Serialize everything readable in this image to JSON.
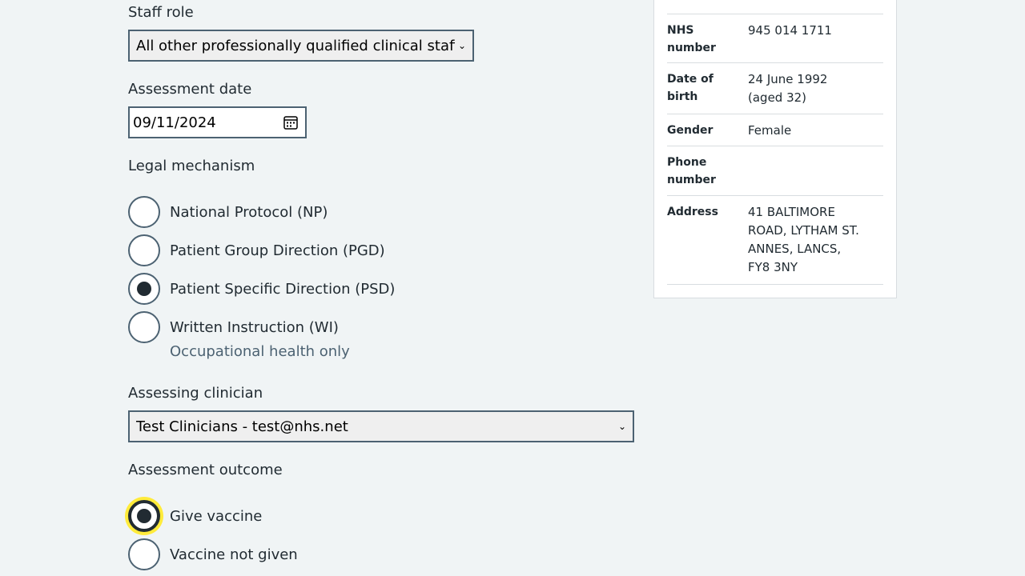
{
  "staff_role": {
    "label": "Staff role",
    "value": "All other professionally qualified clinical staff"
  },
  "assessment_date": {
    "label": "Assessment date",
    "value": "09/11/2024"
  },
  "legal_mechanism": {
    "label": "Legal mechanism",
    "options": [
      {
        "label": "National Protocol (NP)",
        "checked": false
      },
      {
        "label": "Patient Group Direction (PGD)",
        "checked": false
      },
      {
        "label": "Patient Specific Direction (PSD)",
        "checked": true
      },
      {
        "label": "Written Instruction (WI)",
        "checked": false,
        "hint": "Occupational health only"
      }
    ]
  },
  "assessing_clinician": {
    "label": "Assessing clinician",
    "value": "Test Clinicians - test@nhs.net"
  },
  "assessment_outcome": {
    "label": "Assessment outcome",
    "options": [
      {
        "label": "Give vaccine",
        "checked": true,
        "focused": true
      },
      {
        "label": "Vaccine not given",
        "checked": false
      }
    ]
  },
  "patient_summary": {
    "nhs_number": {
      "key": "NHS number",
      "value": "945 014 1711"
    },
    "date_of_birth": {
      "key": "Date of birth",
      "value": "24 June 1992",
      "age": "(aged 32)"
    },
    "gender": {
      "key": "Gender",
      "value": "Female"
    },
    "phone_number": {
      "key": "Phone number",
      "value": ""
    },
    "address": {
      "key": "Address",
      "lines": [
        "41 BALTIMORE",
        "ROAD, LYTHAM ST.",
        "ANNES, LANCS,",
        "FY8 3NY"
      ]
    }
  },
  "colors": {
    "page_background": "#f0f4f5",
    "text": "#212b32",
    "border": "#4c6272",
    "focus": "#ffeb3b"
  },
  "icons": {
    "calendar": "calendar-icon",
    "dropdown": "chevron-down-icon"
  }
}
